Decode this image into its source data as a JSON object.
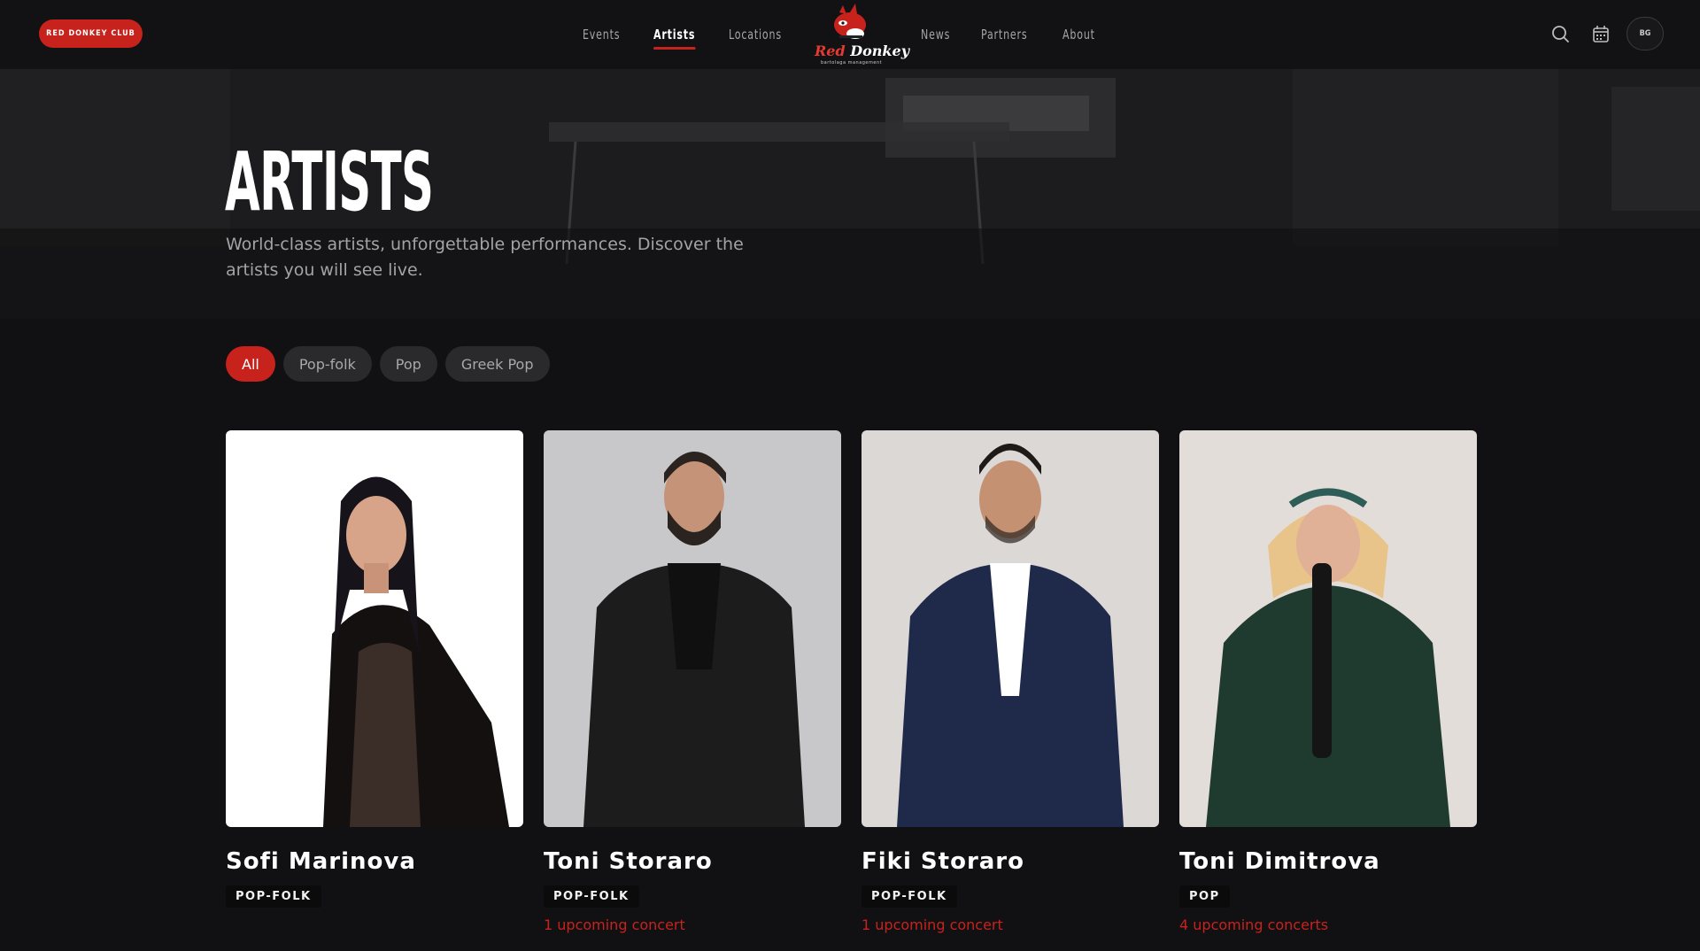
{
  "header": {
    "club_label": "RED DONKEY CLUB",
    "nav_left": [
      "Events",
      "Artists",
      "Locations"
    ],
    "nav_right": [
      "News",
      "Partners",
      "About"
    ],
    "active_nav": "Artists",
    "logo_word1": "Red",
    "logo_word2": "Donkey",
    "logo_sub": "bartolaga management",
    "lang_label": "BG",
    "icons": [
      "search-icon",
      "calendar-icon"
    ]
  },
  "hero": {
    "title": "ARTISTS",
    "subtitle": "World-class artists, unforgettable performances. Discover the artists you will see live."
  },
  "filters": [
    {
      "label": "All",
      "active": true
    },
    {
      "label": "Pop-folk",
      "active": false
    },
    {
      "label": "Pop",
      "active": false
    },
    {
      "label": "Greek Pop",
      "active": false
    }
  ],
  "artists": [
    {
      "name": "Sofi Marinova",
      "genre": "POP-FOLK",
      "concerts": ""
    },
    {
      "name": "Toni Storaro",
      "genre": "POP-FOLK",
      "concerts": "1 upcoming concert"
    },
    {
      "name": "Fiki Storaro",
      "genre": "POP-FOLK",
      "concerts": "1 upcoming concert"
    },
    {
      "name": "Toni Dimitrova",
      "genre": "POP",
      "concerts": "4 upcoming concerts"
    }
  ],
  "colors": {
    "accent": "#c8221c",
    "background": "#111113",
    "chip": "#2a2a2c"
  }
}
